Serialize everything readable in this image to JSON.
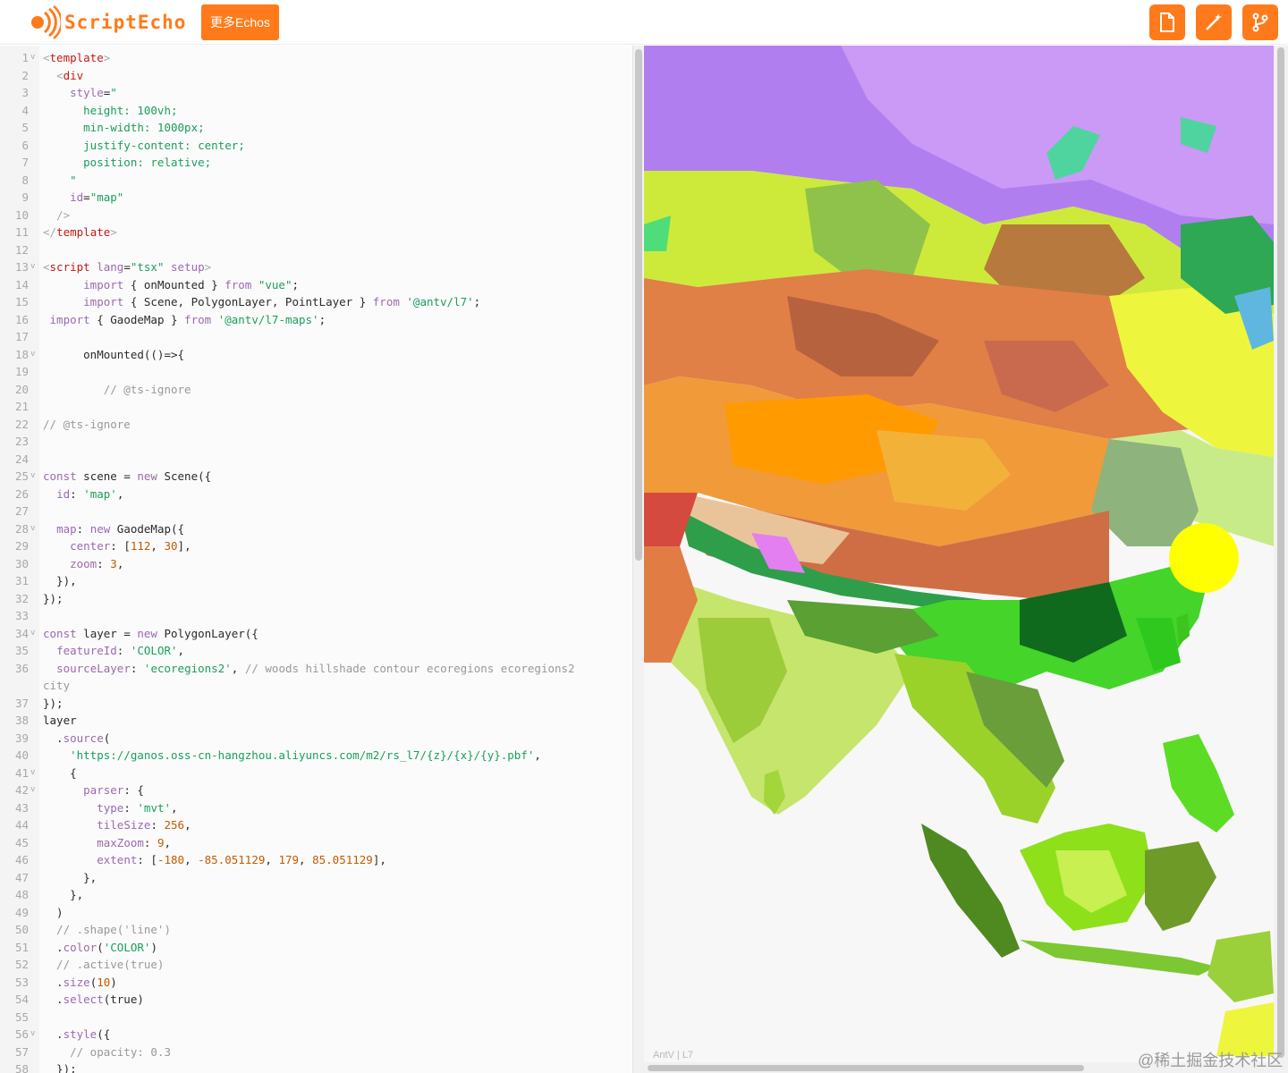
{
  "header": {
    "logo_text": "ScriptEcho",
    "more_button": "更多Echos",
    "icons": [
      "file-icon",
      "magic-wand-icon",
      "git-branch-icon"
    ],
    "accent": "#ff7a1a"
  },
  "editor": {
    "lines": [
      {
        "n": "1",
        "fold": true,
        "t": [
          [
            "c-tag",
            "<"
          ],
          [
            "c-tn",
            "template"
          ],
          [
            "c-tag",
            ">"
          ]
        ]
      },
      {
        "n": "2",
        "fold": false,
        "t": [
          [
            "c-df",
            "  "
          ],
          [
            "c-tag",
            "<"
          ],
          [
            "c-tn",
            "div"
          ]
        ]
      },
      {
        "n": "3",
        "fold": false,
        "t": [
          [
            "c-df",
            "    "
          ],
          [
            "c-attr",
            "style"
          ],
          [
            "c-df",
            "="
          ],
          [
            "c-str",
            "\""
          ]
        ]
      },
      {
        "n": "4",
        "fold": false,
        "t": [
          [
            "c-str",
            "      height: 100vh;"
          ]
        ]
      },
      {
        "n": "5",
        "fold": false,
        "t": [
          [
            "c-str",
            "      min-width: 1000px;"
          ]
        ]
      },
      {
        "n": "6",
        "fold": false,
        "t": [
          [
            "c-str",
            "      justify-content: center;"
          ]
        ]
      },
      {
        "n": "7",
        "fold": false,
        "t": [
          [
            "c-str",
            "      position: relative;"
          ]
        ]
      },
      {
        "n": "8",
        "fold": false,
        "t": [
          [
            "c-str",
            "    \""
          ]
        ]
      },
      {
        "n": "9",
        "fold": false,
        "t": [
          [
            "c-df",
            "    "
          ],
          [
            "c-attr",
            "id"
          ],
          [
            "c-df",
            "="
          ],
          [
            "c-str",
            "\"map\""
          ]
        ]
      },
      {
        "n": "10",
        "fold": false,
        "t": [
          [
            "c-df",
            "  "
          ],
          [
            "c-tag",
            "/>"
          ]
        ]
      },
      {
        "n": "11",
        "fold": false,
        "t": [
          [
            "c-tag",
            "</"
          ],
          [
            "c-tn",
            "template"
          ],
          [
            "c-tag",
            ">"
          ]
        ]
      },
      {
        "n": "12",
        "fold": false,
        "t": []
      },
      {
        "n": "13",
        "fold": true,
        "t": [
          [
            "c-tag",
            "<"
          ],
          [
            "c-tn",
            "script"
          ],
          [
            "c-df",
            " "
          ],
          [
            "c-attr",
            "lang"
          ],
          [
            "c-df",
            "="
          ],
          [
            "c-str",
            "\"tsx\""
          ],
          [
            "c-df",
            " "
          ],
          [
            "c-attr",
            "setup"
          ],
          [
            "c-tag",
            ">"
          ]
        ]
      },
      {
        "n": "14",
        "fold": false,
        "t": [
          [
            "c-df",
            "      "
          ],
          [
            "c-kw",
            "import"
          ],
          [
            "c-df",
            " { onMounted } "
          ],
          [
            "c-kw",
            "from"
          ],
          [
            "c-df",
            " "
          ],
          [
            "c-str",
            "\"vue\""
          ],
          [
            "c-df",
            ";"
          ]
        ]
      },
      {
        "n": "15",
        "fold": false,
        "t": [
          [
            "c-df",
            "      "
          ],
          [
            "c-kw",
            "import"
          ],
          [
            "c-df",
            " { Scene, PolygonLayer, PointLayer } "
          ],
          [
            "c-kw",
            "from"
          ],
          [
            "c-df",
            " "
          ],
          [
            "c-str",
            "'@antv/l7'"
          ],
          [
            "c-df",
            ";"
          ]
        ]
      },
      {
        "n": "16",
        "fold": false,
        "t": [
          [
            "c-df",
            " "
          ],
          [
            "c-kw",
            "import"
          ],
          [
            "c-df",
            " { GaodeMap } "
          ],
          [
            "c-kw",
            "from"
          ],
          [
            "c-df",
            " "
          ],
          [
            "c-str",
            "'@antv/l7-maps'"
          ],
          [
            "c-df",
            ";"
          ]
        ]
      },
      {
        "n": "17",
        "fold": false,
        "t": []
      },
      {
        "n": "18",
        "fold": true,
        "t": [
          [
            "c-df",
            "      onMounted(()=>{"
          ]
        ]
      },
      {
        "n": "19",
        "fold": false,
        "t": []
      },
      {
        "n": "20",
        "fold": false,
        "t": [
          [
            "c-cm",
            "         // @ts-ignore"
          ]
        ]
      },
      {
        "n": "21",
        "fold": false,
        "t": []
      },
      {
        "n": "22",
        "fold": false,
        "t": [
          [
            "c-cm",
            "// @ts-ignore"
          ]
        ]
      },
      {
        "n": "23",
        "fold": false,
        "t": []
      },
      {
        "n": "24",
        "fold": false,
        "t": []
      },
      {
        "n": "25",
        "fold": true,
        "t": [
          [
            "c-kw",
            "const"
          ],
          [
            "c-df",
            " scene = "
          ],
          [
            "c-kw",
            "new"
          ],
          [
            "c-df",
            " Scene({"
          ]
        ]
      },
      {
        "n": "26",
        "fold": false,
        "t": [
          [
            "c-df",
            "  "
          ],
          [
            "c-attr",
            "id"
          ],
          [
            "c-df",
            ": "
          ],
          [
            "c-str",
            "'map'"
          ],
          [
            "c-df",
            ","
          ]
        ]
      },
      {
        "n": "27",
        "fold": false,
        "t": []
      },
      {
        "n": "28",
        "fold": true,
        "t": [
          [
            "c-df",
            "  "
          ],
          [
            "c-attr",
            "map"
          ],
          [
            "c-df",
            ": "
          ],
          [
            "c-kw",
            "new"
          ],
          [
            "c-df",
            " GaodeMap({"
          ]
        ]
      },
      {
        "n": "29",
        "fold": false,
        "t": [
          [
            "c-df",
            "    "
          ],
          [
            "c-attr",
            "center"
          ],
          [
            "c-df",
            ": ["
          ],
          [
            "c-num",
            "112"
          ],
          [
            "c-df",
            ", "
          ],
          [
            "c-num",
            "30"
          ],
          [
            "c-df",
            "],"
          ]
        ]
      },
      {
        "n": "30",
        "fold": false,
        "t": [
          [
            "c-df",
            "    "
          ],
          [
            "c-attr",
            "zoom"
          ],
          [
            "c-df",
            ": "
          ],
          [
            "c-num",
            "3"
          ],
          [
            "c-df",
            ","
          ]
        ]
      },
      {
        "n": "31",
        "fold": false,
        "t": [
          [
            "c-df",
            "  }),"
          ]
        ]
      },
      {
        "n": "32",
        "fold": false,
        "t": [
          [
            "c-df",
            "});"
          ]
        ]
      },
      {
        "n": "33",
        "fold": false,
        "t": []
      },
      {
        "n": "34",
        "fold": true,
        "t": [
          [
            "c-kw",
            "const"
          ],
          [
            "c-df",
            " layer = "
          ],
          [
            "c-kw",
            "new"
          ],
          [
            "c-df",
            " PolygonLayer({"
          ]
        ]
      },
      {
        "n": "35",
        "fold": false,
        "t": [
          [
            "c-df",
            "  "
          ],
          [
            "c-attr",
            "featureId"
          ],
          [
            "c-df",
            ": "
          ],
          [
            "c-str",
            "'COLOR'"
          ],
          [
            "c-df",
            ","
          ]
        ]
      },
      {
        "n": "36",
        "fold": false,
        "t": [
          [
            "c-df",
            "  "
          ],
          [
            "c-attr",
            "sourceLayer"
          ],
          [
            "c-df",
            ": "
          ],
          [
            "c-str",
            "'ecoregions2'"
          ],
          [
            "c-df",
            ", "
          ],
          [
            "c-cm",
            "// woods hillshade contour ecoregions ecoregions2"
          ]
        ]
      },
      {
        "n": "",
        "fold": false,
        "t": [
          [
            "c-cm",
            "city"
          ]
        ]
      },
      {
        "n": "37",
        "fold": false,
        "t": [
          [
            "c-df",
            "});"
          ]
        ]
      },
      {
        "n": "38",
        "fold": false,
        "t": [
          [
            "c-df",
            "layer"
          ]
        ]
      },
      {
        "n": "39",
        "fold": false,
        "t": [
          [
            "c-df",
            "  ."
          ],
          [
            "c-attr",
            "source"
          ],
          [
            "c-df",
            "("
          ]
        ]
      },
      {
        "n": "40",
        "fold": false,
        "t": [
          [
            "c-df",
            "    "
          ],
          [
            "c-str",
            "'https://ganos.oss-cn-hangzhou.aliyuncs.com/m2/rs_l7/{z}/{x}/{y}.pbf'"
          ],
          [
            "c-df",
            ","
          ]
        ]
      },
      {
        "n": "41",
        "fold": true,
        "t": [
          [
            "c-df",
            "    {"
          ]
        ]
      },
      {
        "n": "42",
        "fold": true,
        "t": [
          [
            "c-df",
            "      "
          ],
          [
            "c-attr",
            "parser"
          ],
          [
            "c-df",
            ": {"
          ]
        ]
      },
      {
        "n": "43",
        "fold": false,
        "t": [
          [
            "c-df",
            "        "
          ],
          [
            "c-attr",
            "type"
          ],
          [
            "c-df",
            ": "
          ],
          [
            "c-str",
            "'mvt'"
          ],
          [
            "c-df",
            ","
          ]
        ]
      },
      {
        "n": "44",
        "fold": false,
        "t": [
          [
            "c-df",
            "        "
          ],
          [
            "c-attr",
            "tileSize"
          ],
          [
            "c-df",
            ": "
          ],
          [
            "c-num",
            "256"
          ],
          [
            "c-df",
            ","
          ]
        ]
      },
      {
        "n": "45",
        "fold": false,
        "t": [
          [
            "c-df",
            "        "
          ],
          [
            "c-attr",
            "maxZoom"
          ],
          [
            "c-df",
            ": "
          ],
          [
            "c-num",
            "9"
          ],
          [
            "c-df",
            ","
          ]
        ]
      },
      {
        "n": "46",
        "fold": false,
        "t": [
          [
            "c-df",
            "        "
          ],
          [
            "c-attr",
            "extent"
          ],
          [
            "c-df",
            ": ["
          ],
          [
            "c-num",
            "-180"
          ],
          [
            "c-df",
            ", "
          ],
          [
            "c-num",
            "-85.051129"
          ],
          [
            "c-df",
            ", "
          ],
          [
            "c-num",
            "179"
          ],
          [
            "c-df",
            ", "
          ],
          [
            "c-num",
            "85.051129"
          ],
          [
            "c-df",
            "],"
          ]
        ]
      },
      {
        "n": "47",
        "fold": false,
        "t": [
          [
            "c-df",
            "      },"
          ]
        ]
      },
      {
        "n": "48",
        "fold": false,
        "t": [
          [
            "c-df",
            "    },"
          ]
        ]
      },
      {
        "n": "49",
        "fold": false,
        "t": [
          [
            "c-df",
            "  )"
          ]
        ]
      },
      {
        "n": "50",
        "fold": false,
        "t": [
          [
            "c-cm",
            "  // .shape('line')"
          ]
        ]
      },
      {
        "n": "51",
        "fold": false,
        "t": [
          [
            "c-df",
            "  ."
          ],
          [
            "c-attr",
            "color"
          ],
          [
            "c-df",
            "("
          ],
          [
            "c-str",
            "'COLOR'"
          ],
          [
            "c-df",
            ")"
          ]
        ]
      },
      {
        "n": "52",
        "fold": false,
        "t": [
          [
            "c-cm",
            "  // .active(true)"
          ]
        ]
      },
      {
        "n": "53",
        "fold": false,
        "t": [
          [
            "c-df",
            "  ."
          ],
          [
            "c-attr",
            "size"
          ],
          [
            "c-df",
            "("
          ],
          [
            "c-num",
            "10"
          ],
          [
            "c-df",
            ")"
          ]
        ]
      },
      {
        "n": "54",
        "fold": false,
        "t": [
          [
            "c-df",
            "  ."
          ],
          [
            "c-attr",
            "select"
          ],
          [
            "c-df",
            "(true)"
          ]
        ]
      },
      {
        "n": "55",
        "fold": false,
        "t": []
      },
      {
        "n": "56",
        "fold": true,
        "t": [
          [
            "c-df",
            "  ."
          ],
          [
            "c-attr",
            "style"
          ],
          [
            "c-df",
            "({"
          ]
        ]
      },
      {
        "n": "57",
        "fold": false,
        "t": [
          [
            "c-cm",
            "    // opacity: 0.3"
          ]
        ]
      },
      {
        "n": "58",
        "fold": false,
        "t": [
          [
            "c-df",
            "  });"
          ]
        ]
      }
    ]
  },
  "map": {
    "attribution": "AntV | L7",
    "marker_color": "#ffff00"
  },
  "watermark": "@稀土掘金技术社区"
}
